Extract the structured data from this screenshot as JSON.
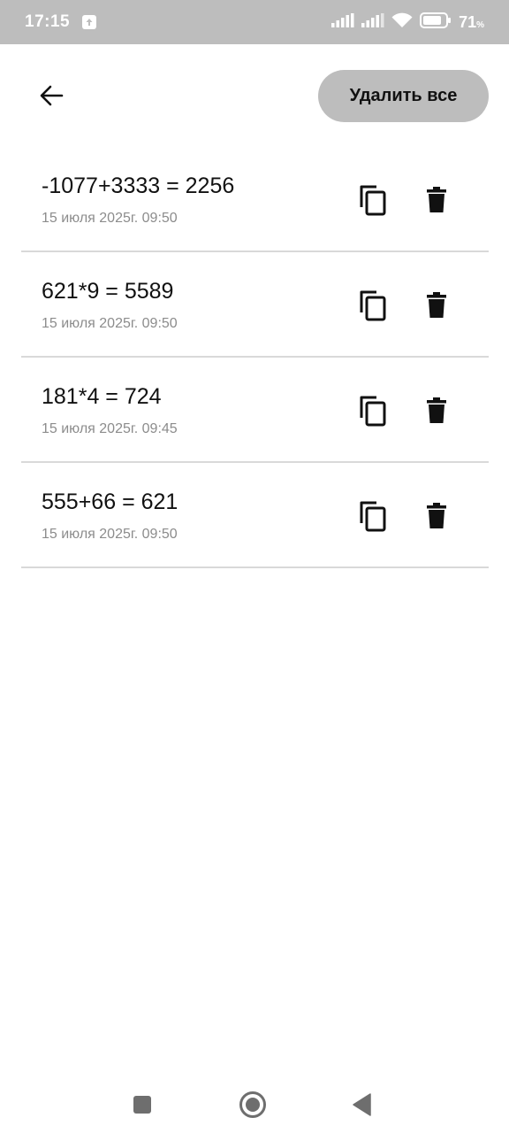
{
  "status_bar": {
    "time": "17:15",
    "battery_level": "71",
    "battery_unit": "%",
    "icons": [
      "upload-icon",
      "signal-icon",
      "signal-icon",
      "wifi-icon",
      "battery-icon"
    ]
  },
  "header": {
    "back_icon": "arrow-left-icon",
    "delete_all_label": "Удалить все"
  },
  "history": [
    {
      "expression": "-1077+3333 = 2256",
      "date": "15 июля 2025г. 09:50"
    },
    {
      "expression": "621*9 = 5589",
      "date": "15 июля 2025г. 09:50"
    },
    {
      "expression": "181*4 = 724",
      "date": "15 июля 2025г. 09:45"
    },
    {
      "expression": "555+66 = 621",
      "date": "15 июля 2025г. 09:50"
    }
  ],
  "item_actions": {
    "copy_icon": "copy-icon",
    "delete_icon": "trash-icon"
  },
  "nav_bar": {
    "icons": [
      "recents-square-icon",
      "home-circle-icon",
      "back-triangle-icon"
    ]
  },
  "colors": {
    "status_bar": "#bdbdbd",
    "button_bg": "#bdbdbd",
    "divider": "#d9d9d9",
    "secondary_text": "#8c8c8c",
    "nav_icon": "#6e6e6e"
  }
}
